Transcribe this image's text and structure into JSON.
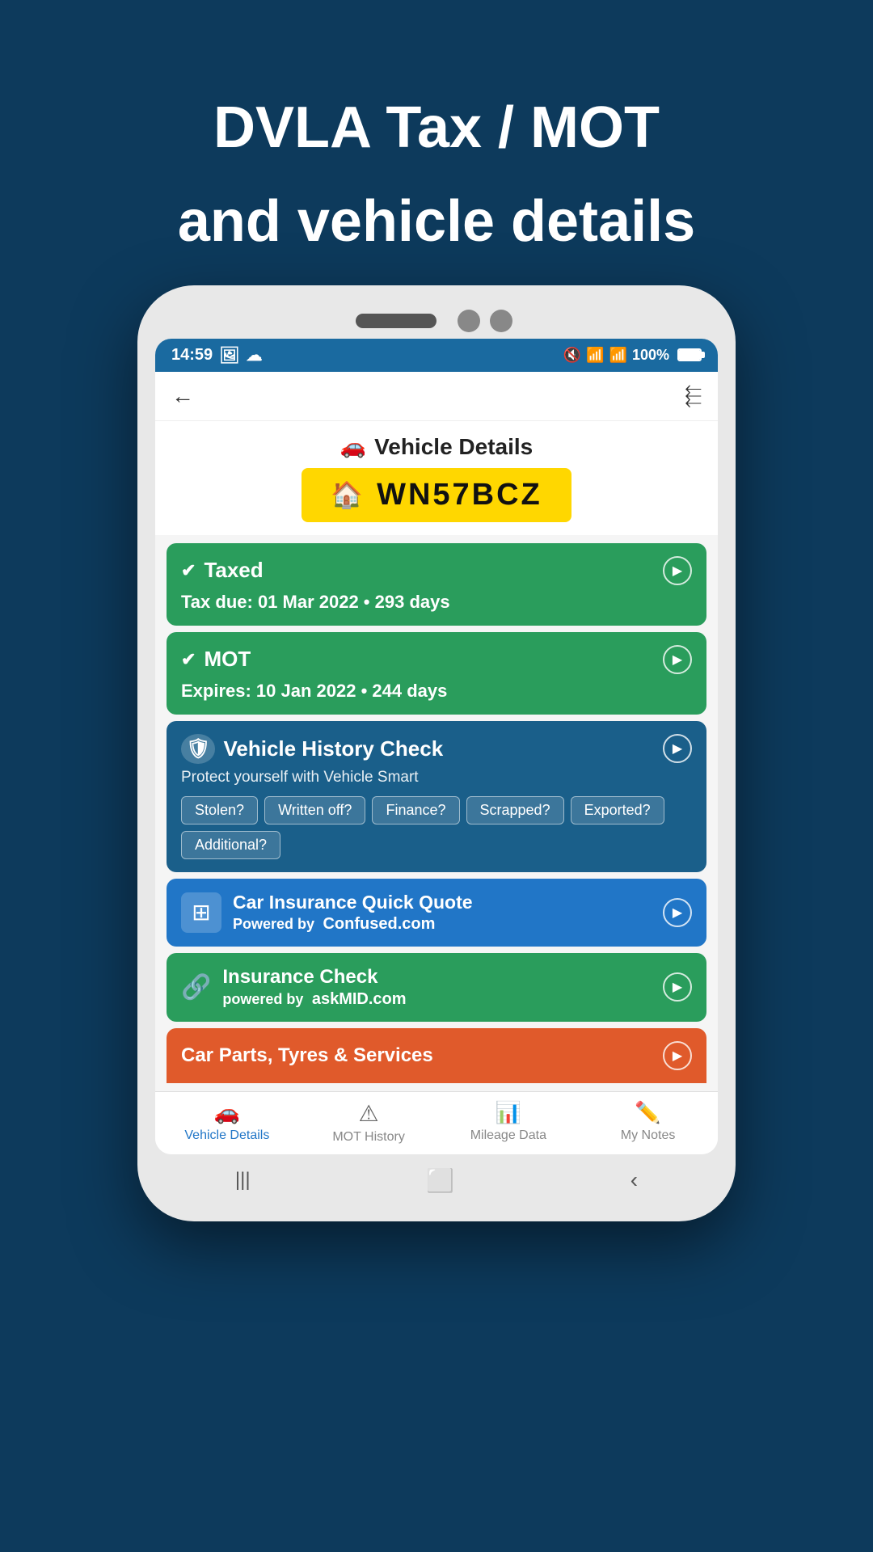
{
  "header": {
    "line1": "DVLA Tax / MOT",
    "line2": "and vehicle details"
  },
  "statusBar": {
    "time": "14:59",
    "battery": "100%"
  },
  "navBar": {
    "backIcon": "←",
    "shareIcon": "⮌"
  },
  "vehicleDetails": {
    "title": "Vehicle Details",
    "plate": "WN57BCZ"
  },
  "taxCard": {
    "title": "Taxed",
    "subtitle": "Tax due: 01 Mar 2022 • 293 days"
  },
  "motCard": {
    "title": "MOT",
    "subtitle": "Expires: 10 Jan 2022 • 244 days"
  },
  "historyCard": {
    "title": "Vehicle History Check",
    "description": "Protect yourself with Vehicle Smart",
    "tags": [
      "Stolen?",
      "Written off?",
      "Finance?",
      "Scrapped?",
      "Exported?",
      "Additional?"
    ]
  },
  "insuranceQuoteCard": {
    "title": "Car Insurance Quick Quote",
    "poweredBy": "Powered by",
    "brand": "Confused.com"
  },
  "insuranceCheckCard": {
    "title": "Insurance Check",
    "poweredBy": "powered by",
    "brand": "askMID.com"
  },
  "partialCard": {
    "title": "Car Parts, Tyres & Services"
  },
  "bottomNav": {
    "items": [
      {
        "label": "Vehicle Details",
        "active": true,
        "icon": "🚗"
      },
      {
        "label": "MOT History",
        "active": false,
        "icon": "⚠"
      },
      {
        "label": "Mileage Data",
        "active": false,
        "icon": "📶"
      },
      {
        "label": "My Notes",
        "active": false,
        "icon": "✏️"
      }
    ]
  },
  "phoneBottom": {
    "back": "‹",
    "home": "⬜",
    "recent": "|||"
  }
}
